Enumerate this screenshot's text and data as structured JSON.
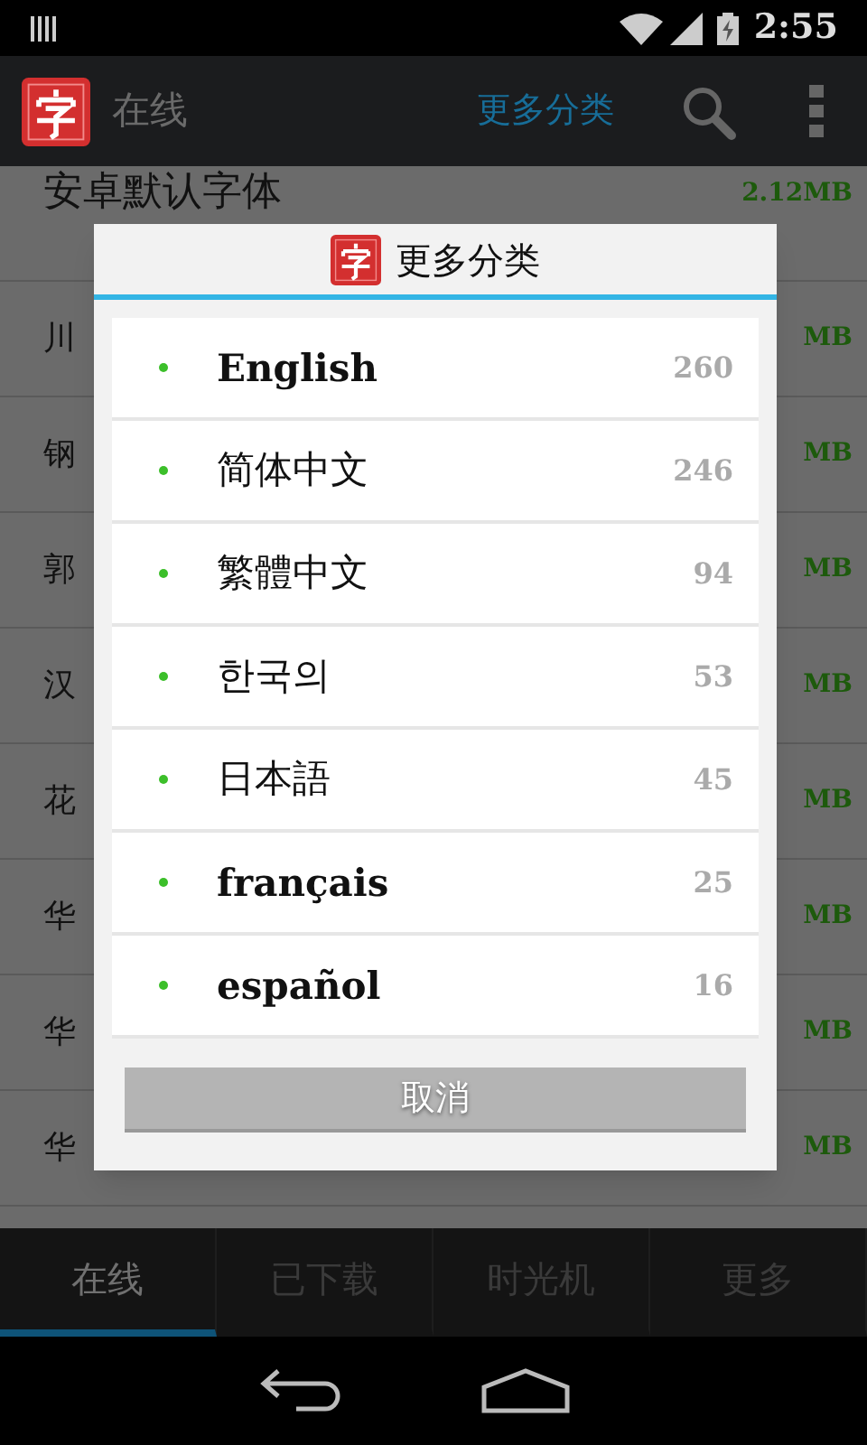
{
  "status_bar": {
    "time": "2:55"
  },
  "action_bar": {
    "title": "在线",
    "menu_label": "更多分类"
  },
  "background_list": [
    {
      "name": "安卓默认字体",
      "size": "2.12MB"
    },
    {
      "name": "川",
      "size": "MB"
    },
    {
      "name": "钢",
      "size": "MB"
    },
    {
      "name": "郭",
      "size": "MB"
    },
    {
      "name": "汉",
      "size": "MB"
    },
    {
      "name": "花",
      "size": "MB"
    },
    {
      "name": "华",
      "size": "MB"
    },
    {
      "name": "华",
      "size": "MB"
    },
    {
      "name": "华",
      "size": "MB"
    }
  ],
  "dialog": {
    "title": "更多分类",
    "items": [
      {
        "label": "English",
        "count": "260",
        "serif": true
      },
      {
        "label": "简体中文",
        "count": "246",
        "serif": false
      },
      {
        "label": "繁體中文",
        "count": "94",
        "serif": false
      },
      {
        "label": "한국의",
        "count": "53",
        "serif": false
      },
      {
        "label": "日本語",
        "count": "45",
        "serif": false
      },
      {
        "label": "français",
        "count": "25",
        "serif": true
      },
      {
        "label": "español",
        "count": "16",
        "serif": true
      }
    ],
    "cancel": "取消"
  },
  "bottom_tabs": [
    {
      "label": "在线",
      "selected": true
    },
    {
      "label": "已下载",
      "selected": false
    },
    {
      "label": "时光机",
      "selected": false
    },
    {
      "label": "更多",
      "selected": false
    }
  ]
}
